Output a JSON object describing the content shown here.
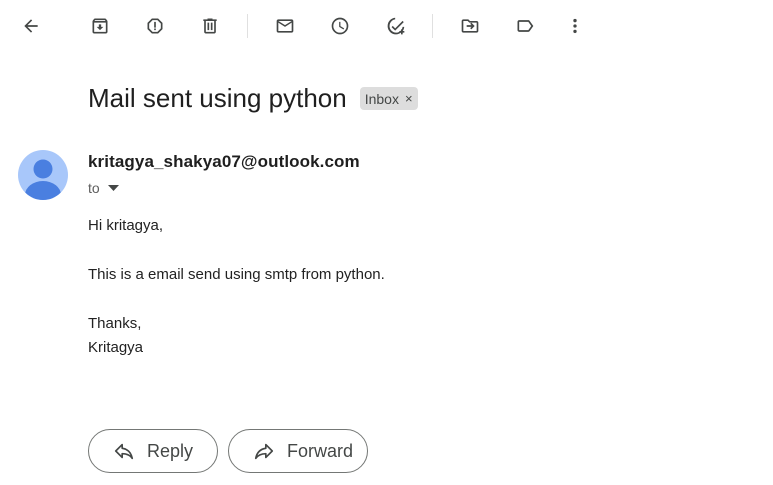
{
  "toolbar": {
    "icons": [
      "back-arrow-icon",
      "archive-icon",
      "report-spam-icon",
      "delete-icon",
      "mark-unread-icon",
      "snooze-icon",
      "add-to-tasks-icon",
      "move-to-icon",
      "label-icon",
      "more-options-icon"
    ]
  },
  "message": {
    "subject": "Mail sent using python",
    "label": "Inbox",
    "label_remove": "×",
    "sender": "kritagya_shakya07@outlook.com",
    "to": "to",
    "body": {
      "greeting": "Hi kritagya,",
      "line1": "This is a email send using smtp from python.",
      "closing": "Thanks,",
      "signature": "Kritagya"
    }
  },
  "actions": {
    "reply": "Reply",
    "forward": "Forward"
  },
  "colors": {
    "icon": "#444746",
    "avatar_bg": "#a8c7fa",
    "avatar_fg": "#4a7fe0",
    "chip_bg": "#dddddd"
  }
}
